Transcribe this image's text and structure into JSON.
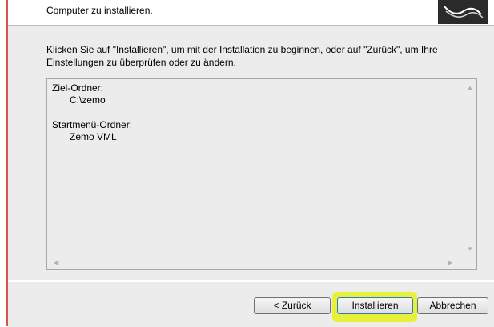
{
  "header": {
    "subtitle": "Computer zu installieren."
  },
  "main": {
    "description": "Klicken Sie auf \"Installieren\", um mit der Installation zu beginnen, oder auf \"Zurück\", um Ihre Einstellungen zu überprüfen oder zu ändern.",
    "summary": {
      "dest_label": "Ziel-Ordner:",
      "dest_value": "C:\\zemo",
      "startmenu_label": "Startmenü-Ordner:",
      "startmenu_value": "Zemo VML"
    }
  },
  "buttons": {
    "back": "< Zurück",
    "install": "Installieren",
    "cancel": "Abbrechen"
  },
  "icons": {
    "logo": "setup-logo-icon",
    "scroll_up": "scroll-up-arrow-icon",
    "scroll_down": "scroll-down-arrow-icon",
    "scroll_left": "scroll-left-arrow-icon",
    "scroll_right": "scroll-right-arrow-icon"
  },
  "colors": {
    "highlight": "#e8f226",
    "accent_border": "#d9534f"
  }
}
